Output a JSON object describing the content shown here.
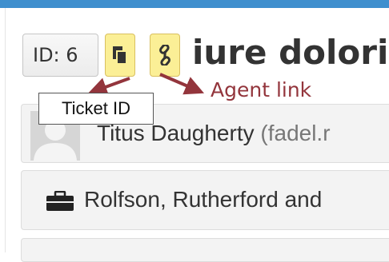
{
  "ticket": {
    "id_label": "ID: 6",
    "title": "iure dolori"
  },
  "contact": {
    "name": "Titus Daugherty",
    "email": "(fadel.r"
  },
  "company": {
    "name": "Rolfson, Rutherford and"
  },
  "tooltip": {
    "text": "Ticket ID"
  },
  "annotation": {
    "text": "Agent link",
    "color": "#93353c"
  },
  "icons": {
    "copy": "copy-icon",
    "link": "link-icon",
    "briefcase": "briefcase-icon",
    "avatar": "avatar-placeholder"
  },
  "colors": {
    "top_bar": "#3f8fce",
    "highlight_button": "#fbef96"
  }
}
